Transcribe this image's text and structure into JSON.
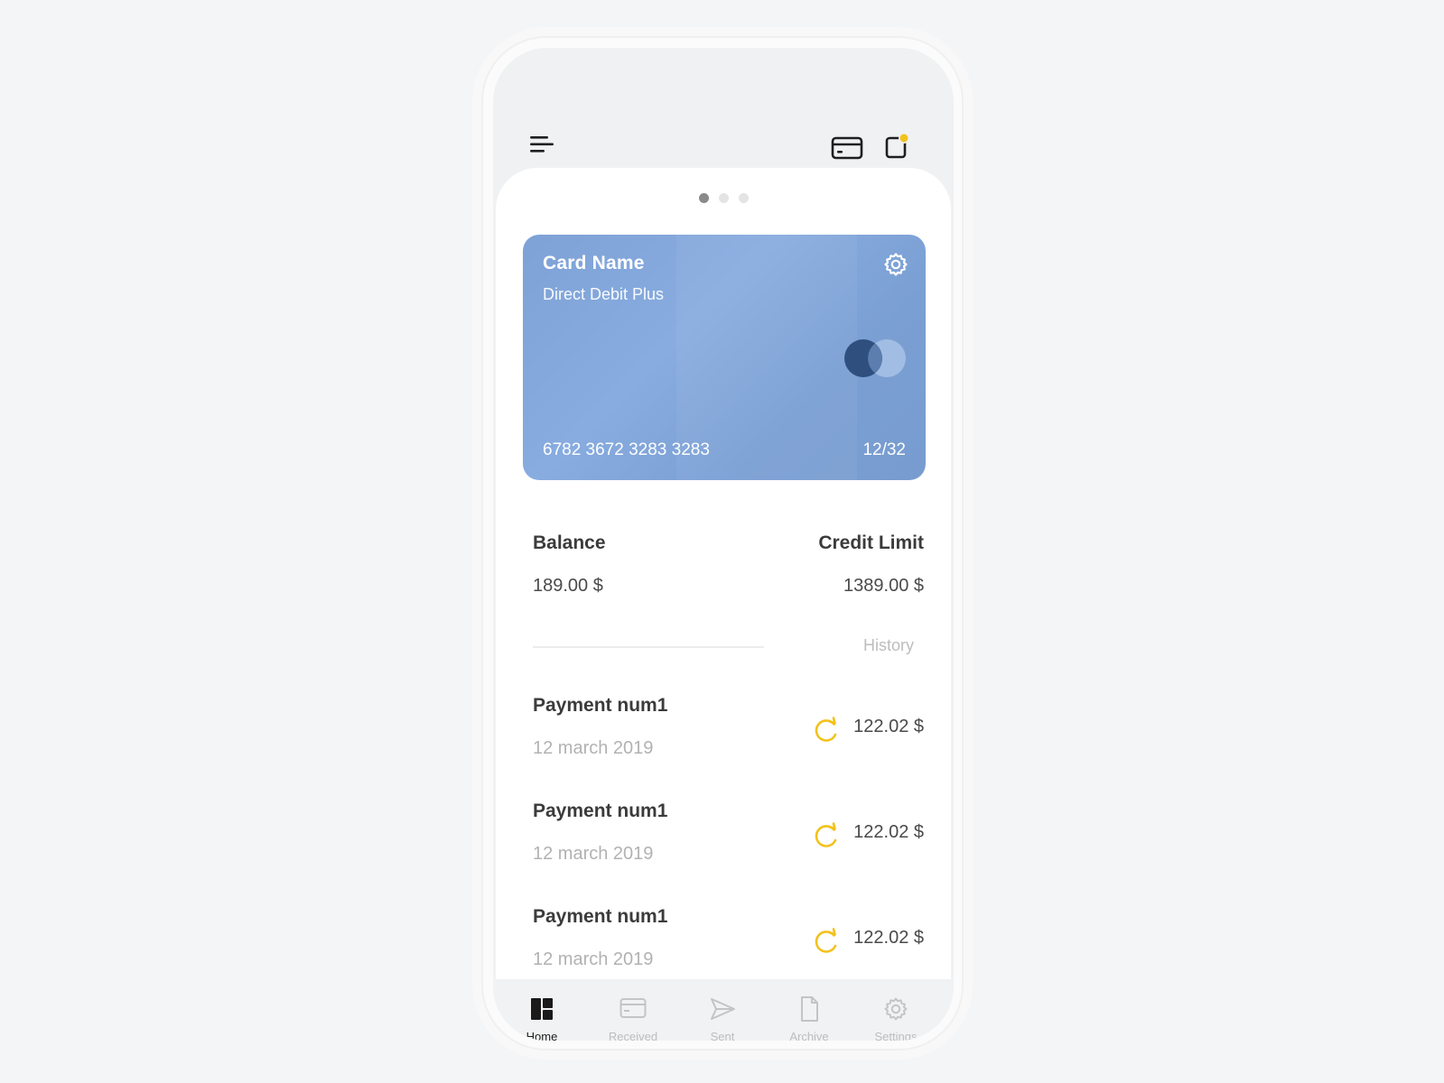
{
  "card": {
    "name_label": "Card Name",
    "type": "Direct Debit Plus",
    "number": "6782 3672 3283 3283",
    "expiry": "12/32",
    "color": "#84a7da"
  },
  "pager": {
    "pages": 3,
    "active": 0
  },
  "summary": {
    "balance_label": "Balance",
    "balance_value": "189.00 $",
    "limit_label": "Credit Limit",
    "limit_value": "1389.00 $"
  },
  "history_label": "History",
  "payments": [
    {
      "title": "Payment num1",
      "date": "12 march 2019",
      "amount": "122.02 $",
      "status_icon": "pending-refresh-icon"
    },
    {
      "title": "Payment num1",
      "date": "12 march 2019",
      "amount": "122.02 $",
      "status_icon": "pending-refresh-icon"
    },
    {
      "title": "Payment num1",
      "date": "12 march 2019",
      "amount": "122.02 $",
      "status_icon": "pending-refresh-icon"
    }
  ],
  "tabs": [
    {
      "label": "Home",
      "icon": "dashboard-icon",
      "active": true
    },
    {
      "label": "Received",
      "icon": "card-icon",
      "active": false
    },
    {
      "label": "Sent",
      "icon": "paper-plane-icon",
      "active": false
    },
    {
      "label": "Archive",
      "icon": "document-icon",
      "active": false
    },
    {
      "label": "Settings",
      "icon": "gear-icon",
      "active": false
    }
  ],
  "colors": {
    "accent": "#f2c21b",
    "text_dark": "#3b3b3b",
    "text_muted": "#b2b2b2"
  }
}
